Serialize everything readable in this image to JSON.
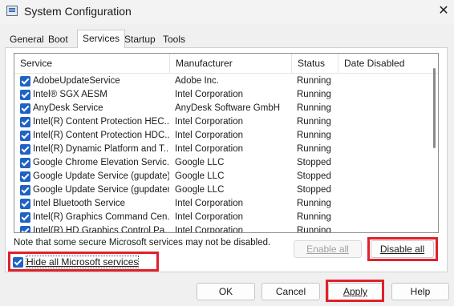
{
  "window": {
    "title": "System Configuration",
    "close_glyph": "✕"
  },
  "tabs": [
    "General",
    "Boot",
    "Services",
    "Startup",
    "Tools"
  ],
  "active_tab": "Services",
  "columns": [
    "Service",
    "Manufacturer",
    "Status",
    "Date Disabled"
  ],
  "services": [
    {
      "name": "AdobeUpdateService",
      "manufacturer": "Adobe Inc.",
      "status": "Running",
      "checked": true
    },
    {
      "name": "Intel® SGX AESM",
      "manufacturer": "Intel Corporation",
      "status": "Running",
      "checked": true
    },
    {
      "name": "AnyDesk Service",
      "manufacturer": "AnyDesk Software GmbH",
      "status": "Running",
      "checked": true
    },
    {
      "name": "Intel(R) Content Protection HEC...",
      "manufacturer": "Intel Corporation",
      "status": "Running",
      "checked": true
    },
    {
      "name": "Intel(R) Content Protection HDC...",
      "manufacturer": "Intel Corporation",
      "status": "Running",
      "checked": true
    },
    {
      "name": "Intel(R) Dynamic Platform and T...",
      "manufacturer": "Intel Corporation",
      "status": "Running",
      "checked": true
    },
    {
      "name": "Google Chrome Elevation Servic...",
      "manufacturer": "Google LLC",
      "status": "Stopped",
      "checked": true
    },
    {
      "name": "Google Update Service (gupdate)",
      "manufacturer": "Google LLC",
      "status": "Stopped",
      "checked": true
    },
    {
      "name": "Google Update Service (gupdatem)",
      "manufacturer": "Google LLC",
      "status": "Stopped",
      "checked": true
    },
    {
      "name": "Intel Bluetooth Service",
      "manufacturer": "Intel Corporation",
      "status": "Running",
      "checked": true
    },
    {
      "name": "Intel(R) Graphics Command Cen...",
      "manufacturer": "Intel Corporation",
      "status": "Running",
      "checked": true
    },
    {
      "name": "Intel(R) HD Graphics Control Pa...",
      "manufacturer": "Intel Corporation",
      "status": "Running",
      "checked": true
    }
  ],
  "note": "Note that some secure Microsoft services may not be disabled.",
  "buttons": {
    "enable_all": "Enable all",
    "disable_all": "Disable all",
    "ok": "OK",
    "cancel": "Cancel",
    "apply": "Apply",
    "help": "Help"
  },
  "hide_ms": {
    "label": "Hide all Microsoft services",
    "checked": true
  },
  "colors": {
    "highlight": "#e0202c",
    "checkbox": "#1f62c6"
  }
}
